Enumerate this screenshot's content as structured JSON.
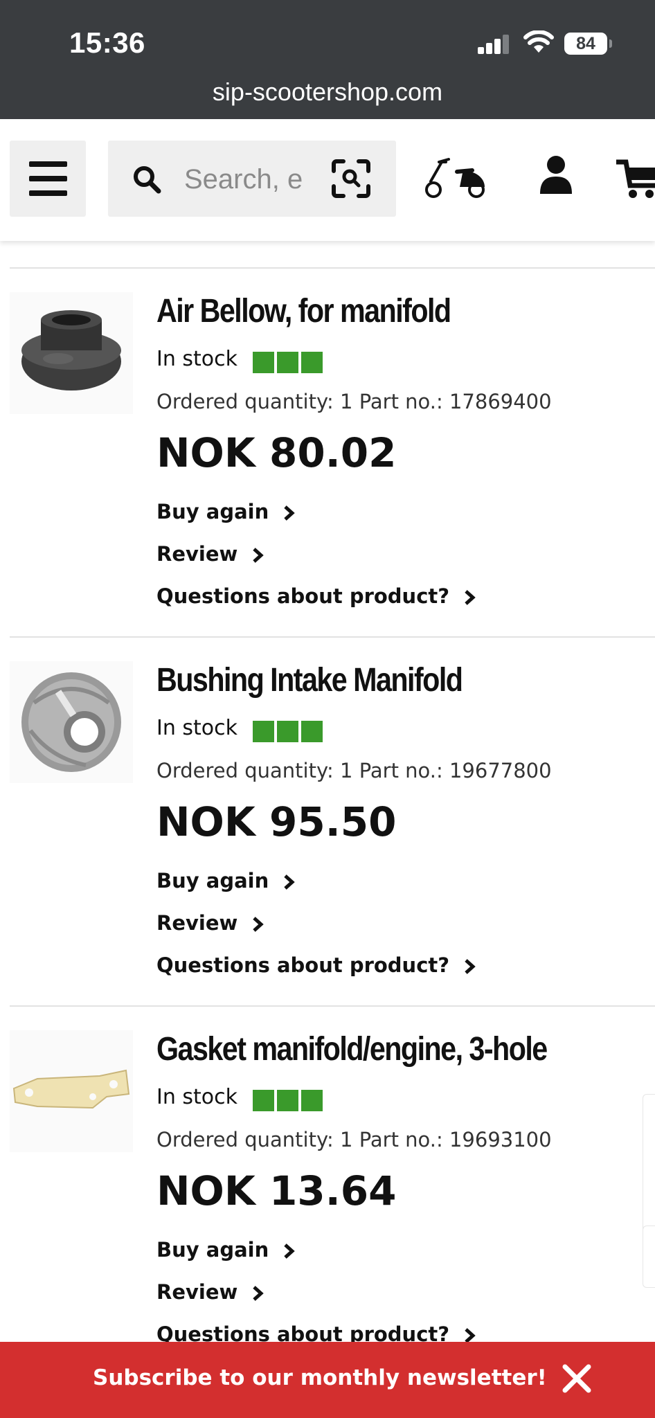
{
  "status_bar": {
    "time": "15:36",
    "battery": "84",
    "url": "sip-scootershop.com"
  },
  "header": {
    "search_placeholder": "Search, e",
    "icons": [
      "menu-icon",
      "search-icon",
      "scan-icon",
      "scooter-icon",
      "user-icon",
      "cart-icon"
    ]
  },
  "colors": {
    "status_bar_bg": "#3a3d40",
    "stock_green": "#3a9a2b",
    "newsletter_red": "#d32f2f"
  },
  "orders": [
    {
      "title": "Air Bellow, for manifold",
      "stock": "In stock",
      "stock_level": 3,
      "meta": "Ordered quantity: 1 Part no.: 17869400",
      "price": "NOK 80.02",
      "buy_again": "Buy again",
      "review": "Review",
      "questions": "Questions about product?"
    },
    {
      "title": "Bushing Intake Manifold",
      "stock": "In stock",
      "stock_level": 3,
      "meta": "Ordered quantity: 1 Part no.: 19677800",
      "price": "NOK 95.50",
      "buy_again": "Buy again",
      "review": "Review",
      "questions": "Questions about product?"
    },
    {
      "title": "Gasket manifold/engine, 3-hole",
      "stock": "In stock",
      "stock_level": 3,
      "meta": "Ordered quantity: 1 Part no.: 19693100",
      "price": "NOK 13.64",
      "buy_again": "Buy again",
      "review": "Review",
      "questions": "Questions about product?"
    }
  ],
  "newsletter": {
    "text": "Subscribe to our monthly newsletter!"
  }
}
